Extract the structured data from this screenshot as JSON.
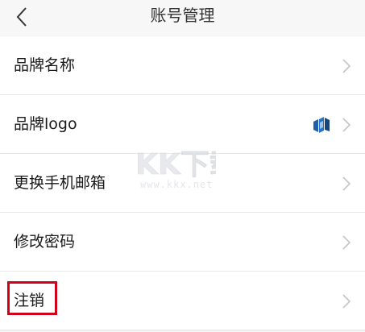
{
  "header": {
    "title": "账号管理"
  },
  "items": [
    {
      "label": "品牌名称"
    },
    {
      "label": "品牌logo"
    },
    {
      "label": "更换手机邮箱"
    },
    {
      "label": "修改密码"
    },
    {
      "label": "注销"
    }
  ],
  "watermark": {
    "text": "KK下载",
    "url": "www.kkx.net"
  },
  "colors": {
    "highlight": "#d0021b",
    "chevron": "#c4c4c4",
    "logo_primary": "#1f5fa8"
  }
}
